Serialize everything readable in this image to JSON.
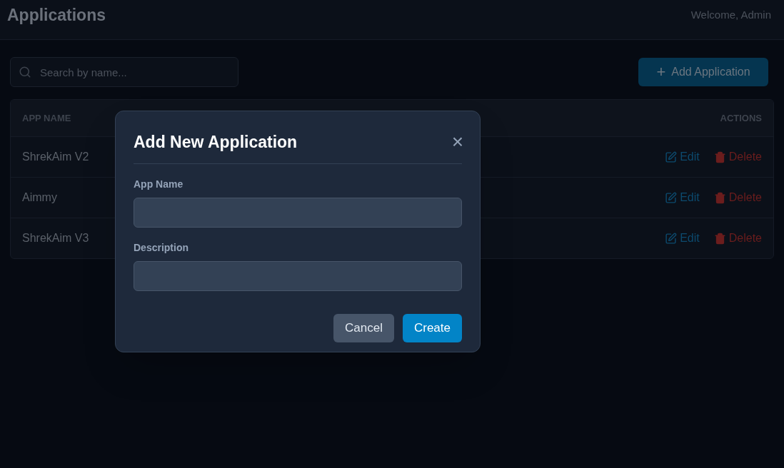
{
  "header": {
    "title": "Applications",
    "welcome": "Welcome, Admin"
  },
  "search": {
    "placeholder": "Search by name..."
  },
  "add_button": {
    "label": "Add Application",
    "icon": "+"
  },
  "table": {
    "columns": [
      "APP NAME",
      "ACTIONS"
    ],
    "rows": [
      {
        "name": "ShrekAim V2",
        "edit": "Edit",
        "delete": "Delete"
      },
      {
        "name": "Aimmy",
        "edit": "Edit",
        "delete": "Delete"
      },
      {
        "name": "ShrekAim V3",
        "edit": "Edit",
        "delete": "Delete"
      }
    ]
  },
  "dialog": {
    "title": "Add New Application",
    "close": "×",
    "fields": [
      {
        "label": "App Name"
      },
      {
        "label": "Description"
      }
    ],
    "buttons": [
      {
        "label": "Cancel",
        "kind": "secondary"
      },
      {
        "label": "Create",
        "kind": "primary"
      }
    ]
  }
}
